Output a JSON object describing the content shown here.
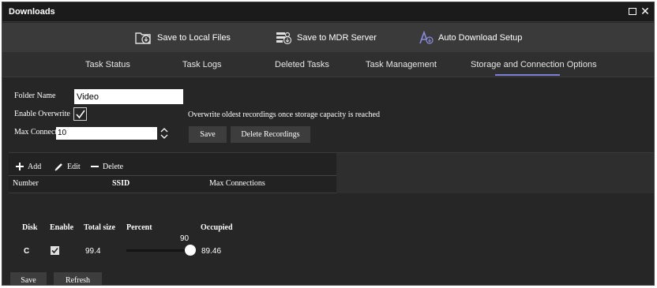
{
  "window": {
    "title": "Downloads"
  },
  "actions": {
    "save_local": "Save to Local Files",
    "save_mdr": "Save to MDR Server",
    "auto_download": "Auto Download Setup"
  },
  "tabs": [
    {
      "label": "Task Status",
      "active": false
    },
    {
      "label": "Task Logs",
      "active": false
    },
    {
      "label": "Deleted Tasks",
      "active": false
    },
    {
      "label": "Task Management",
      "active": false
    },
    {
      "label": "Storage and Connection Options",
      "active": true
    }
  ],
  "form": {
    "folder_name_label": "Folder Name",
    "folder_name_value": "Video",
    "enable_overwrite_label": "Enable Overwrite",
    "enable_overwrite_checked": true,
    "overwrite_note": "Overwrite oldest recordings once storage capacity is reached",
    "max_connections_label": "Max Connections",
    "max_connections_value": "10",
    "save_label": "Save",
    "delete_recordings_label": "Delete Recordings"
  },
  "connections": {
    "add_label": "Add",
    "edit_label": "Edit",
    "delete_label": "Delete",
    "columns": [
      "Number",
      "SSID",
      "Max Connections"
    ],
    "rows": []
  },
  "disks": {
    "columns": [
      "Disk",
      "Enable",
      "Total size",
      "Percent",
      "Occupied"
    ],
    "rows": [
      {
        "disk": "C",
        "enabled": true,
        "total_size": "99.4",
        "percent": 90,
        "percent_label": "90",
        "occupied": "89.46"
      }
    ]
  },
  "footer": {
    "save_label": "Save",
    "refresh_label": "Refresh"
  },
  "colors": {
    "window_bg": "#262626",
    "tab_underline": "#7d7fd3",
    "accent_icon": "#8a8cd8"
  }
}
